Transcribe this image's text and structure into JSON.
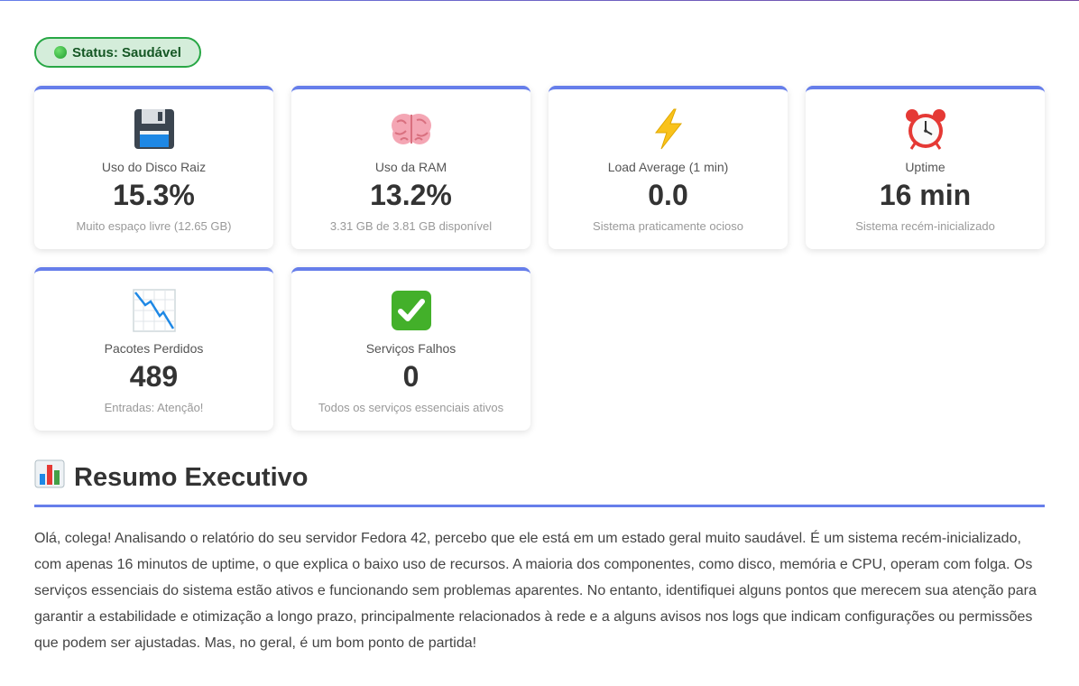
{
  "status": {
    "label": "Status: Saudável",
    "color": "#28a745"
  },
  "accent": "#667eea",
  "cards": [
    {
      "icon": "floppy-disk-icon",
      "label": "Uso do Disco Raiz",
      "value": "15.3%",
      "note": "Muito espaço livre (12.65 GB)"
    },
    {
      "icon": "brain-icon",
      "label": "Uso da RAM",
      "value": "13.2%",
      "note": "3.31 GB de 3.81 GB disponível"
    },
    {
      "icon": "lightning-icon",
      "label": "Load Average (1 min)",
      "value": "0.0",
      "note": "Sistema praticamente ocioso"
    },
    {
      "icon": "alarm-clock-icon",
      "label": "Uptime",
      "value": "16 min",
      "note": "Sistema recém-inicializado"
    },
    {
      "icon": "chart-decreasing-icon",
      "label": "Pacotes Perdidos",
      "value": "489",
      "note": "Entradas: Atenção!"
    },
    {
      "icon": "check-mark-icon",
      "label": "Serviços Falhos",
      "value": "0",
      "note": "Todos os serviços essenciais ativos"
    }
  ],
  "summary_section": {
    "icon": "bar-chart-icon",
    "title": "Resumo Executivo",
    "text": "Olá, colega! Analisando o relatório do seu servidor Fedora 42, percebo que ele está em um estado geral muito saudável. É um sistema recém-inicializado, com apenas 16 minutos de uptime, o que explica o baixo uso de recursos. A maioria dos componentes, como disco, memória e CPU, operam com folga. Os serviços essenciais do sistema estão ativos e funcionando sem problemas aparentes. No entanto, identifiquei alguns pontos que merecem sua atenção para garantir a estabilidade e otimização a longo prazo, principalmente relacionados à rede e a alguns avisos nos logs que indicam configurações ou permissões que podem ser ajustadas. Mas, no geral, é um bom ponto de partida!"
  }
}
